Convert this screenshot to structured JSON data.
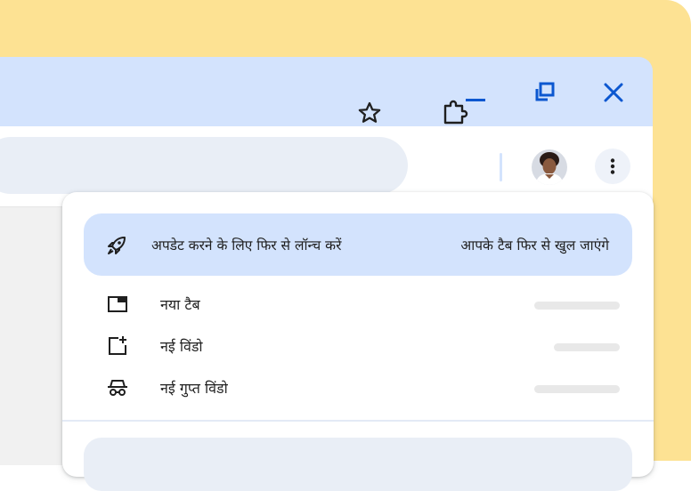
{
  "colors": {
    "background": "#fde293",
    "window_frame": "#d3e3fd",
    "accent": "#0b57d0",
    "update_highlight": "#d3e3fd",
    "text": "#1f1f1f"
  },
  "window_controls": {
    "minimize_icon": "minimize-icon",
    "restore_icon": "restore-icon",
    "close_icon": "close-icon"
  },
  "toolbar": {
    "bookmark_icon": "star-icon",
    "extensions_icon": "puzzle-icon",
    "profile_icon": "avatar",
    "menu_icon": "kebab-menu-icon"
  },
  "menu": {
    "update": {
      "label": "अपडेट करने के लिए फिर से लॉन्च करें",
      "sublabel": "आपके टैब फिर से खुल जाएंगे",
      "icon": "rocket-icon"
    },
    "items": [
      {
        "label": "नया टैब",
        "icon": "new-tab-icon"
      },
      {
        "label": "नई विंडो",
        "icon": "new-window-icon"
      },
      {
        "label": "नई गुप्त विंडो",
        "icon": "incognito-icon"
      }
    ]
  }
}
